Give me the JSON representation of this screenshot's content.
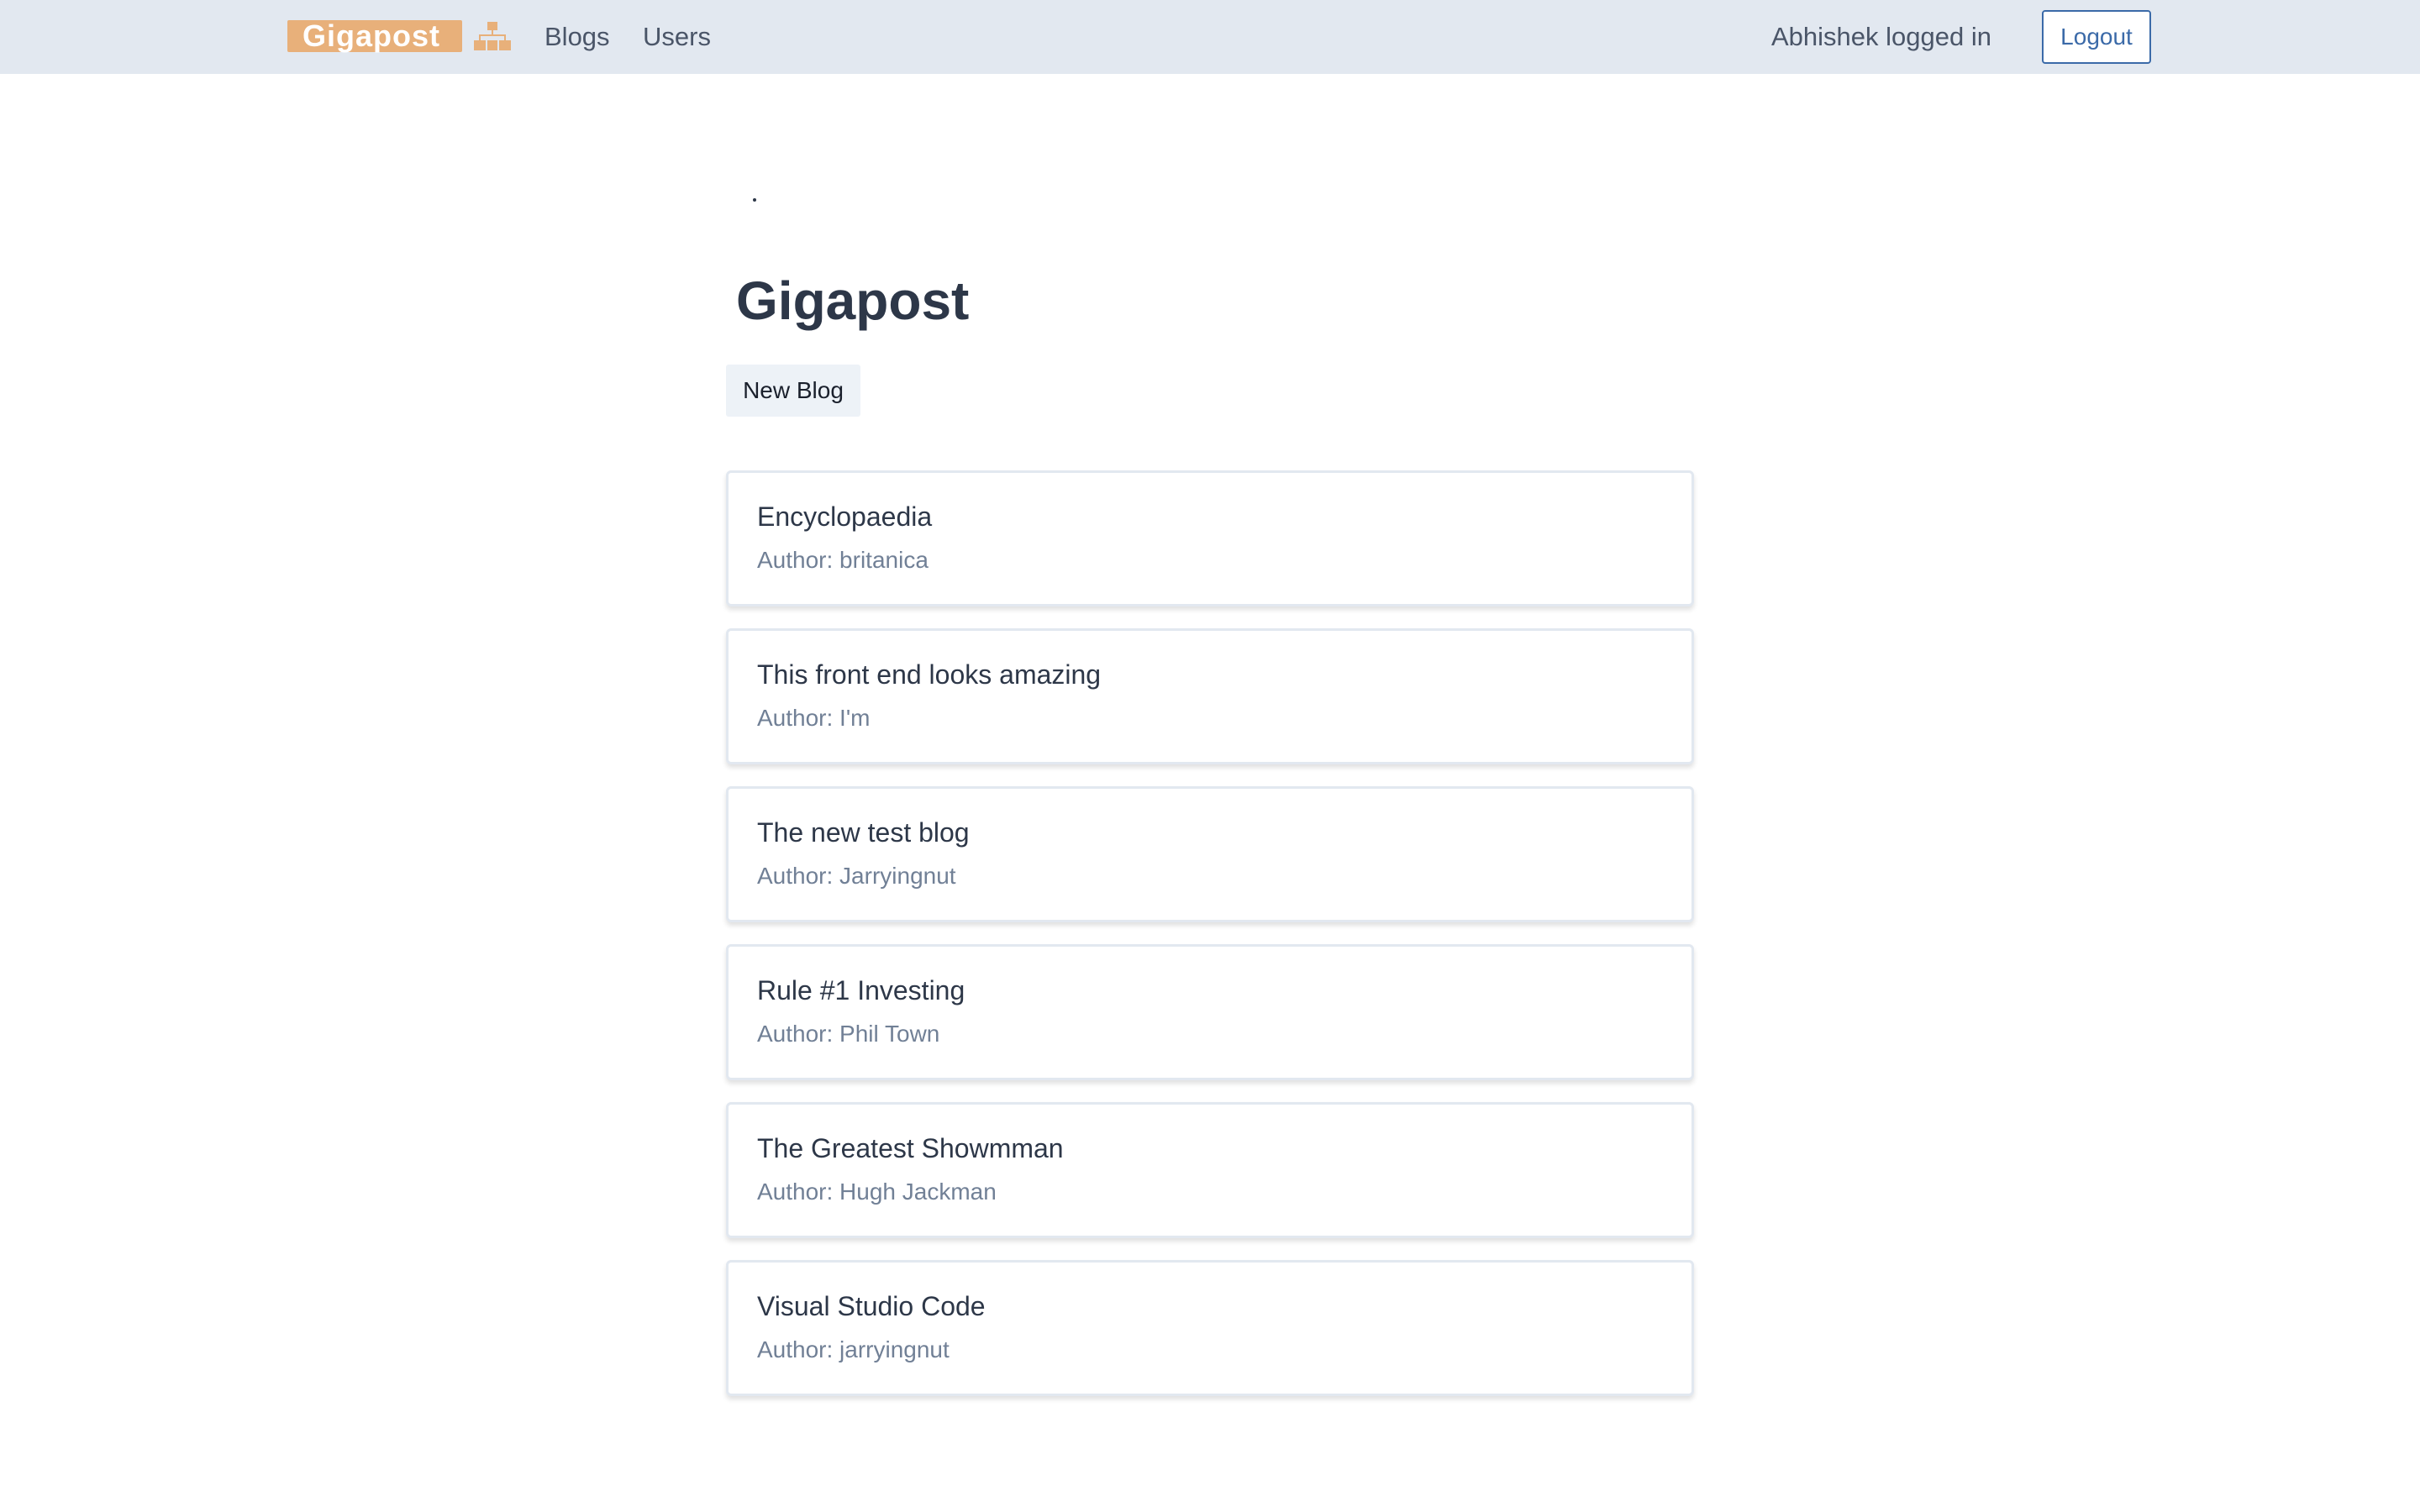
{
  "navbar": {
    "logo_text": "Gigapost",
    "logo_icon": "sitemap-icon",
    "links": {
      "blogs": "Blogs",
      "users": "Users"
    },
    "logged_in_text": "Abhishek logged in",
    "logout_label": "Logout"
  },
  "main": {
    "title": "Gigapost",
    "new_blog_label": "New Blog",
    "blogs": [
      {
        "title": "Encyclopaedia",
        "author": "Author: britanica"
      },
      {
        "title": "This front end looks amazing",
        "author": "Author: I'm"
      },
      {
        "title": "The new test blog",
        "author": "Author: Jarryingnut"
      },
      {
        "title": "Rule #1 Investing",
        "author": "Author: Phil Town"
      },
      {
        "title": "The Greatest Showmman",
        "author": "Author: Hugh Jackman"
      },
      {
        "title": "Visual Studio Code",
        "author": "Author: jarryingnut"
      }
    ]
  },
  "colors": {
    "navbar_bg": "#e2e8f0",
    "logo_accent": "#e8b07a",
    "logout_blue": "#3b6aa8"
  }
}
